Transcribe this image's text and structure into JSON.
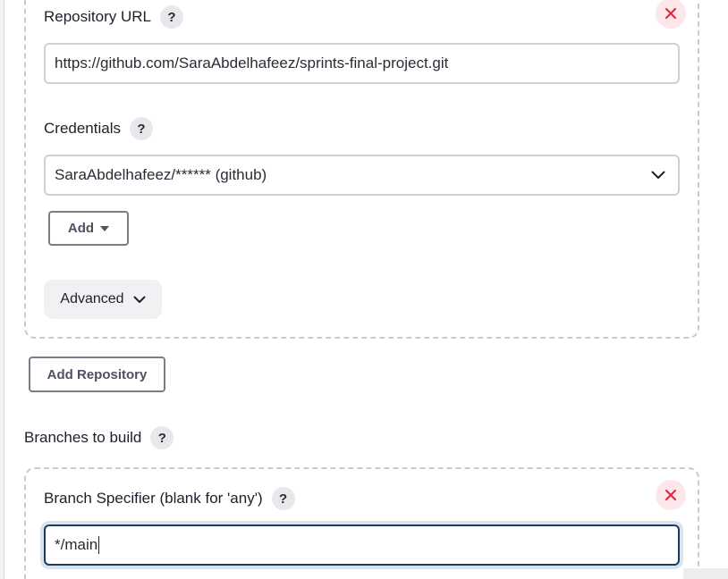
{
  "repository": {
    "url_label": "Repository URL",
    "url_value": "https://github.com/SaraAbdelhafeez/sprints-final-project.git",
    "credentials_label": "Credentials",
    "credentials_value": "SaraAbdelhafeez/****** (github)",
    "add_label": "Add",
    "advanced_label": "Advanced"
  },
  "add_repository_label": "Add Repository",
  "branches": {
    "section_label": "Branches to build",
    "specifier_label": "Branch Specifier (blank for 'any')",
    "specifier_value": "*/main"
  },
  "help_glyph": "?",
  "icons": {
    "remove": "close-icon",
    "chevron": "chevron-down-icon",
    "caret": "caret-down-icon"
  },
  "colors": {
    "remove_icon": "#e0243a",
    "focus_border": "#1f3b57",
    "focus_ring": "#d6e4f2"
  }
}
